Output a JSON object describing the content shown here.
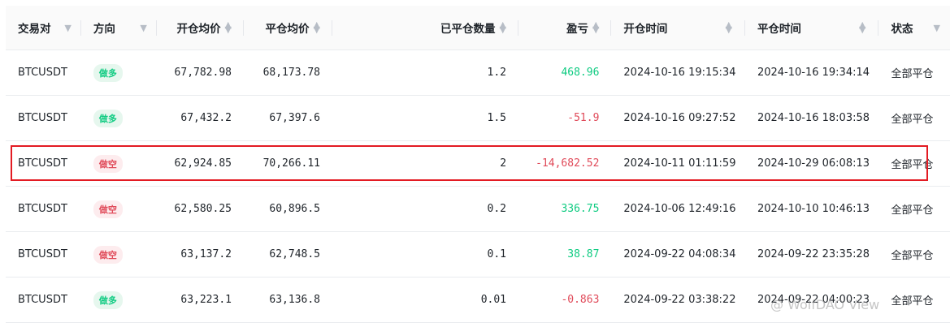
{
  "header": {
    "pair": "交易对",
    "direction": "方向",
    "open_avg": "开仓均价",
    "close_avg": "平仓均价",
    "closed_qty": "已平仓数量",
    "pnl": "盈亏",
    "open_time": "开仓时间",
    "close_time": "平仓时间",
    "status": "状态"
  },
  "rows": [
    {
      "pair": "BTCUSDT",
      "direction": "做多",
      "side": "long",
      "open_avg": "67,782.98",
      "close_avg": "68,173.78",
      "closed_qty": "1.2",
      "pnl": "468.96",
      "pnl_sign": "pos",
      "open_time": "2024-10-16 19:15:34",
      "close_time": "2024-10-16 19:34:14",
      "status": "全部平仓"
    },
    {
      "pair": "BTCUSDT",
      "direction": "做多",
      "side": "long",
      "open_avg": "67,432.2",
      "close_avg": "67,397.6",
      "closed_qty": "1.5",
      "pnl": "-51.9",
      "pnl_sign": "neg",
      "open_time": "2024-10-16 09:27:52",
      "close_time": "2024-10-16 18:03:58",
      "status": "全部平仓"
    },
    {
      "pair": "BTCUSDT",
      "direction": "做空",
      "side": "short",
      "open_avg": "62,924.85",
      "close_avg": "70,266.11",
      "closed_qty": "2",
      "pnl": "-14,682.52",
      "pnl_sign": "neg",
      "open_time": "2024-10-11 01:11:59",
      "close_time": "2024-10-29 06:08:13",
      "status": "全部平仓"
    },
    {
      "pair": "BTCUSDT",
      "direction": "做空",
      "side": "short",
      "open_avg": "62,580.25",
      "close_avg": "60,896.5",
      "closed_qty": "0.2",
      "pnl": "336.75",
      "pnl_sign": "pos",
      "open_time": "2024-10-06 12:49:16",
      "close_time": "2024-10-10 10:46:13",
      "status": "全部平仓"
    },
    {
      "pair": "BTCUSDT",
      "direction": "做空",
      "side": "short",
      "open_avg": "63,137.2",
      "close_avg": "62,748.5",
      "closed_qty": "0.1",
      "pnl": "38.87",
      "pnl_sign": "pos",
      "open_time": "2024-09-22 04:08:34",
      "close_time": "2024-09-22 23:35:28",
      "status": "全部平仓"
    },
    {
      "pair": "BTCUSDT",
      "direction": "做多",
      "side": "long",
      "open_avg": "63,223.1",
      "close_avg": "63,136.8",
      "closed_qty": "0.01",
      "pnl": "-0.863",
      "pnl_sign": "neg",
      "open_time": "2024-09-22 03:38:22",
      "close_time": "2024-09-22 04:00:23",
      "status": "全部平仓"
    }
  ],
  "watermark": "@ WolfDAO View",
  "colors": {
    "profit": "#0ecb81",
    "loss": "#e04a59",
    "highlight_box": "#e31b23"
  }
}
